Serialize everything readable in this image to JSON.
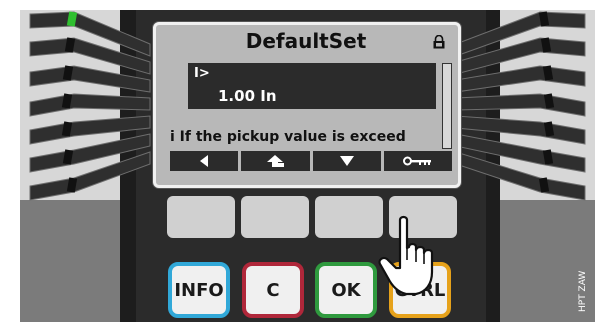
{
  "display": {
    "title": "DefaultSet",
    "parameter_name": "I>",
    "parameter_value": "1.00 In",
    "info_line": "i If the pickup value is exceed"
  },
  "softkeys": [
    {
      "icon": "arrow-left-icon"
    },
    {
      "icon": "parent-menu-icon"
    },
    {
      "icon": "arrow-down-icon"
    },
    {
      "icon": "key-icon"
    }
  ],
  "function_keys": [
    {
      "label": "INFO",
      "color": "#31a8d8"
    },
    {
      "label": "C",
      "color": "#b0273a"
    },
    {
      "label": "OK",
      "color": "#2f9a3e"
    },
    {
      "label": "CTRL",
      "color": "#e6a21b"
    }
  ],
  "watermark": "HPT ZAW",
  "colors": {
    "screen": "#b8b8b8",
    "highlight": "#2b2b2b",
    "led_green": "#33cc33"
  }
}
